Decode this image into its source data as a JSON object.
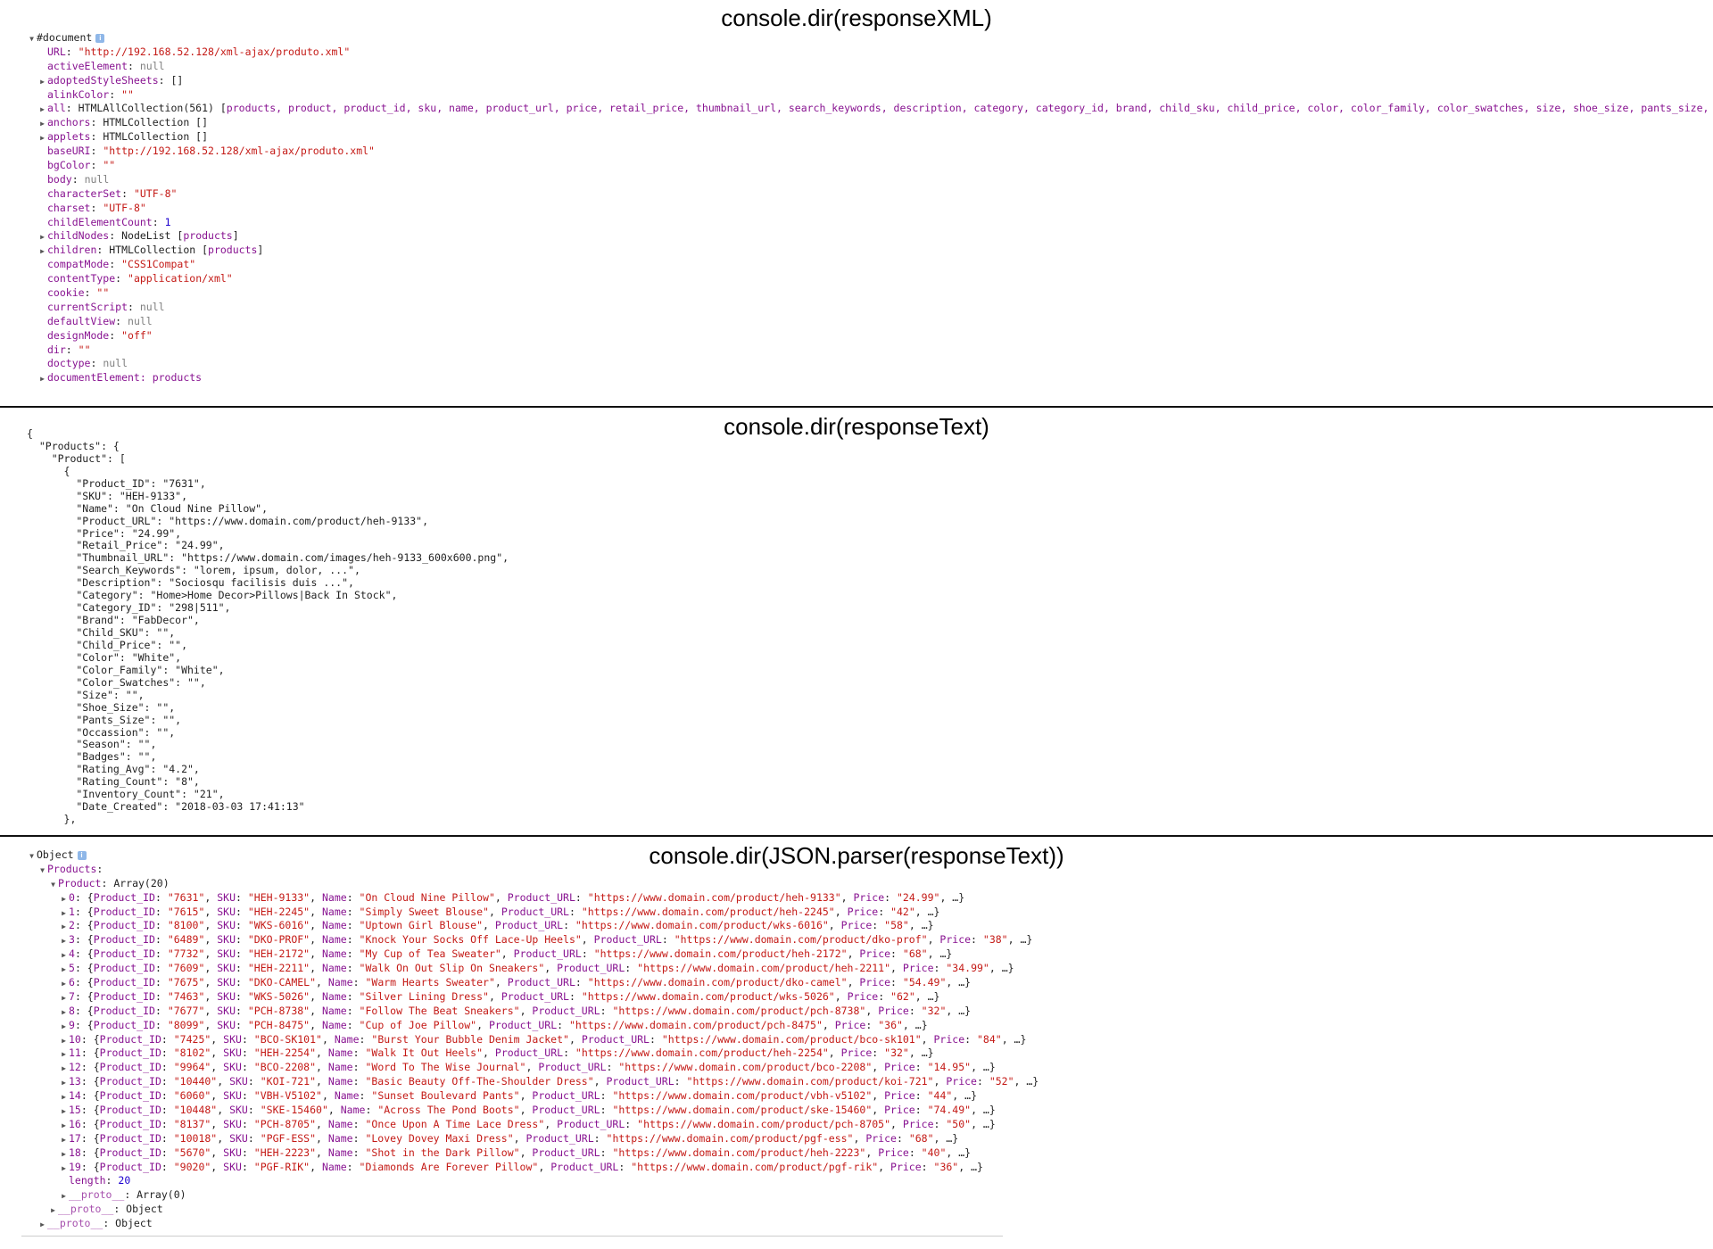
{
  "panels": [
    {
      "caption": "console.dir(responseXML)",
      "lines": [
        {
          "indent": 0,
          "arrow": "open",
          "parts": [
            {
              "t": "#document",
              "c": "plain"
            }
          ],
          "info": true
        },
        {
          "indent": 1,
          "parts": [
            {
              "t": "URL",
              "c": "key"
            },
            {
              "t": ": ",
              "c": "plain"
            },
            {
              "t": "\"http://192.168.52.128/xml-ajax/produto.xml\"",
              "c": "str"
            }
          ]
        },
        {
          "indent": 1,
          "parts": [
            {
              "t": "activeElement",
              "c": "key"
            },
            {
              "t": ": ",
              "c": "plain"
            },
            {
              "t": "null",
              "c": "null"
            }
          ]
        },
        {
          "indent": 1,
          "arrow": "closed",
          "parts": [
            {
              "t": "adoptedStyleSheets",
              "c": "key"
            },
            {
              "t": ": []",
              "c": "plain"
            }
          ]
        },
        {
          "indent": 1,
          "parts": [
            {
              "t": "alinkColor",
              "c": "key"
            },
            {
              "t": ": ",
              "c": "plain"
            },
            {
              "t": "\"\"",
              "c": "str"
            }
          ]
        },
        {
          "indent": 1,
          "arrow": "closed",
          "parts": [
            {
              "t": "all",
              "c": "key"
            },
            {
              "t": ": HTMLAllCollection(561) [",
              "c": "plain"
            },
            {
              "t": "products, product, product_id, sku, name, product_url, price, retail_price, thumbnail_url, search_keywords, description, category, category_id, brand, child_sku, child_price, color, color_family, color_swatches, size, shoe_size, pants_size, …",
              "c": "key"
            }
          ]
        },
        {
          "indent": 1,
          "arrow": "closed",
          "parts": [
            {
              "t": "anchors",
              "c": "key"
            },
            {
              "t": ": HTMLCollection []",
              "c": "plain"
            }
          ]
        },
        {
          "indent": 1,
          "arrow": "closed",
          "parts": [
            {
              "t": "applets",
              "c": "key"
            },
            {
              "t": ": HTMLCollection []",
              "c": "plain"
            }
          ]
        },
        {
          "indent": 1,
          "parts": [
            {
              "t": "baseURI",
              "c": "key"
            },
            {
              "t": ": ",
              "c": "plain"
            },
            {
              "t": "\"http://192.168.52.128/xml-ajax/produto.xml\"",
              "c": "str"
            }
          ]
        },
        {
          "indent": 1,
          "parts": [
            {
              "t": "bgColor",
              "c": "key"
            },
            {
              "t": ": ",
              "c": "plain"
            },
            {
              "t": "\"\"",
              "c": "str"
            }
          ]
        },
        {
          "indent": 1,
          "parts": [
            {
              "t": "body",
              "c": "key"
            },
            {
              "t": ": ",
              "c": "plain"
            },
            {
              "t": "null",
              "c": "null"
            }
          ]
        },
        {
          "indent": 1,
          "parts": [
            {
              "t": "characterSet",
              "c": "key"
            },
            {
              "t": ": ",
              "c": "plain"
            },
            {
              "t": "\"UTF-8\"",
              "c": "str"
            }
          ]
        },
        {
          "indent": 1,
          "parts": [
            {
              "t": "charset",
              "c": "key"
            },
            {
              "t": ": ",
              "c": "plain"
            },
            {
              "t": "\"UTF-8\"",
              "c": "str"
            }
          ]
        },
        {
          "indent": 1,
          "parts": [
            {
              "t": "childElementCount",
              "c": "key"
            },
            {
              "t": ": ",
              "c": "plain"
            },
            {
              "t": "1",
              "c": "num"
            }
          ]
        },
        {
          "indent": 1,
          "arrow": "closed",
          "parts": [
            {
              "t": "childNodes",
              "c": "key"
            },
            {
              "t": ": NodeList [",
              "c": "plain"
            },
            {
              "t": "products",
              "c": "key"
            },
            {
              "t": "]",
              "c": "plain"
            }
          ]
        },
        {
          "indent": 1,
          "arrow": "closed",
          "parts": [
            {
              "t": "children",
              "c": "key"
            },
            {
              "t": ": HTMLCollection [",
              "c": "plain"
            },
            {
              "t": "products",
              "c": "key"
            },
            {
              "t": "]",
              "c": "plain"
            }
          ]
        },
        {
          "indent": 1,
          "parts": [
            {
              "t": "compatMode",
              "c": "key"
            },
            {
              "t": ": ",
              "c": "plain"
            },
            {
              "t": "\"CSS1Compat\"",
              "c": "str"
            }
          ]
        },
        {
          "indent": 1,
          "parts": [
            {
              "t": "contentType",
              "c": "key"
            },
            {
              "t": ": ",
              "c": "plain"
            },
            {
              "t": "\"application/xml\"",
              "c": "str"
            }
          ]
        },
        {
          "indent": 1,
          "parts": [
            {
              "t": "cookie",
              "c": "key"
            },
            {
              "t": ": ",
              "c": "plain"
            },
            {
              "t": "\"\"",
              "c": "str"
            }
          ]
        },
        {
          "indent": 1,
          "parts": [
            {
              "t": "currentScript",
              "c": "key"
            },
            {
              "t": ": ",
              "c": "plain"
            },
            {
              "t": "null",
              "c": "null"
            }
          ]
        },
        {
          "indent": 1,
          "parts": [
            {
              "t": "defaultView",
              "c": "key"
            },
            {
              "t": ": ",
              "c": "plain"
            },
            {
              "t": "null",
              "c": "null"
            }
          ]
        },
        {
          "indent": 1,
          "parts": [
            {
              "t": "designMode",
              "c": "key"
            },
            {
              "t": ": ",
              "c": "plain"
            },
            {
              "t": "\"off\"",
              "c": "str"
            }
          ]
        },
        {
          "indent": 1,
          "parts": [
            {
              "t": "dir",
              "c": "key"
            },
            {
              "t": ": ",
              "c": "plain"
            },
            {
              "t": "\"\"",
              "c": "str"
            }
          ]
        },
        {
          "indent": 1,
          "parts": [
            {
              "t": "doctype",
              "c": "key"
            },
            {
              "t": ": ",
              "c": "plain"
            },
            {
              "t": "null",
              "c": "null"
            }
          ]
        },
        {
          "indent": 1,
          "arrow": "closed",
          "parts": [
            {
              "t": "documentElement",
              "c": "key"
            },
            {
              "t": ": products",
              "c": "key"
            }
          ]
        }
      ]
    },
    {
      "caption": "console.dir(responseText)",
      "json_lines": [
        "{",
        "  \"Products\": {",
        "    \"Product\": [",
        "      {",
        "        \"Product_ID\": \"7631\",",
        "        \"SKU\": \"HEH-9133\",",
        "        \"Name\": \"On Cloud Nine Pillow\",",
        "        \"Product_URL\": \"https://www.domain.com/product/heh-9133\",",
        "        \"Price\": \"24.99\",",
        "        \"Retail_Price\": \"24.99\",",
        "        \"Thumbnail_URL\": \"https://www.domain.com/images/heh-9133_600x600.png\",",
        "        \"Search_Keywords\": \"lorem, ipsum, dolor, ...\",",
        "        \"Description\": \"Sociosqu facilisis duis ...\",",
        "        \"Category\": \"Home>Home Decor>Pillows|Back In Stock\",",
        "        \"Category_ID\": \"298|511\",",
        "        \"Brand\": \"FabDecor\",",
        "        \"Child_SKU\": \"\",",
        "        \"Child_Price\": \"\",",
        "        \"Color\": \"White\",",
        "        \"Color_Family\": \"White\",",
        "        \"Color_Swatches\": \"\",",
        "        \"Size\": \"\",",
        "        \"Shoe_Size\": \"\",",
        "        \"Pants_Size\": \"\",",
        "        \"Occassion\": \"\",",
        "        \"Season\": \"\",",
        "        \"Badges\": \"\",",
        "        \"Rating_Avg\": \"4.2\",",
        "        \"Rating_Count\": \"8\",",
        "        \"Inventory_Count\": \"21\",",
        "        \"Date_Created\": \"2018-03-03 17:41:13\"",
        "      },"
      ]
    },
    {
      "caption": "console.dir(JSON.parser(responseText))",
      "lines": [
        {
          "indent": 0,
          "arrow": "open",
          "parts": [
            {
              "t": "Object",
              "c": "plain"
            }
          ],
          "info": true
        },
        {
          "indent": 1,
          "arrow": "open",
          "parts": [
            {
              "t": "Products",
              "c": "key"
            },
            {
              "t": ":",
              "c": "plain"
            }
          ]
        },
        {
          "indent": 2,
          "arrow": "open",
          "parts": [
            {
              "t": "Product",
              "c": "key"
            },
            {
              "t": ": Array(20)",
              "c": "plain"
            }
          ]
        },
        {
          "indent": 3,
          "arrow": "closed",
          "row": {
            "i": "0",
            "id": "7631",
            "sku": "HEH-9133",
            "name": "On Cloud Nine Pillow",
            "url": "https://www.domain.com/product/heh-9133",
            "price": "24.99"
          }
        },
        {
          "indent": 3,
          "arrow": "closed",
          "row": {
            "i": "1",
            "id": "7615",
            "sku": "HEH-2245",
            "name": "Simply Sweet Blouse",
            "url": "https://www.domain.com/product/heh-2245",
            "price": "42"
          }
        },
        {
          "indent": 3,
          "arrow": "closed",
          "row": {
            "i": "2",
            "id": "8100",
            "sku": "WKS-6016",
            "name": "Uptown Girl Blouse",
            "url": "https://www.domain.com/product/wks-6016",
            "price": "58"
          }
        },
        {
          "indent": 3,
          "arrow": "closed",
          "row": {
            "i": "3",
            "id": "6489",
            "sku": "DKO-PROF",
            "name": "Knock Your Socks Off Lace-Up Heels",
            "url": "https://www.domain.com/product/dko-prof",
            "price": "38"
          }
        },
        {
          "indent": 3,
          "arrow": "closed",
          "row": {
            "i": "4",
            "id": "7732",
            "sku": "HEH-2172",
            "name": "My Cup of Tea Sweater",
            "url": "https://www.domain.com/product/heh-2172",
            "price": "68"
          }
        },
        {
          "indent": 3,
          "arrow": "closed",
          "row": {
            "i": "5",
            "id": "7609",
            "sku": "HEH-2211",
            "name": "Walk On Out Slip On Sneakers",
            "url": "https://www.domain.com/product/heh-2211",
            "price": "34.99"
          }
        },
        {
          "indent": 3,
          "arrow": "closed",
          "row": {
            "i": "6",
            "id": "7675",
            "sku": "DKO-CAMEL",
            "name": "Warm Hearts Sweater",
            "url": "https://www.domain.com/product/dko-camel",
            "price": "54.49"
          }
        },
        {
          "indent": 3,
          "arrow": "closed",
          "row": {
            "i": "7",
            "id": "7463",
            "sku": "WKS-5026",
            "name": "Silver Lining Dress",
            "url": "https://www.domain.com/product/wks-5026",
            "price": "62"
          }
        },
        {
          "indent": 3,
          "arrow": "closed",
          "row": {
            "i": "8",
            "id": "7677",
            "sku": "PCH-8738",
            "name": "Follow The Beat Sneakers",
            "url": "https://www.domain.com/product/pch-8738",
            "price": "32"
          }
        },
        {
          "indent": 3,
          "arrow": "closed",
          "row": {
            "i": "9",
            "id": "8099",
            "sku": "PCH-8475",
            "name": "Cup of Joe Pillow",
            "url": "https://www.domain.com/product/pch-8475",
            "price": "36"
          }
        },
        {
          "indent": 3,
          "arrow": "closed",
          "row": {
            "i": "10",
            "id": "7425",
            "sku": "BCO-SK101",
            "name": "Burst Your Bubble Denim Jacket",
            "url": "https://www.domain.com/product/bco-sk101",
            "price": "84"
          }
        },
        {
          "indent": 3,
          "arrow": "closed",
          "row": {
            "i": "11",
            "id": "8102",
            "sku": "HEH-2254",
            "name": "Walk It Out Heels",
            "url": "https://www.domain.com/product/heh-2254",
            "price": "32"
          }
        },
        {
          "indent": 3,
          "arrow": "closed",
          "row": {
            "i": "12",
            "id": "9964",
            "sku": "BCO-2208",
            "name": "Word To The Wise Journal",
            "url": "https://www.domain.com/product/bco-2208",
            "price": "14.95"
          }
        },
        {
          "indent": 3,
          "arrow": "closed",
          "row": {
            "i": "13",
            "id": "10440",
            "sku": "KOI-721",
            "name": "Basic Beauty Off-The-Shoulder Dress",
            "url": "https://www.domain.com/product/koi-721",
            "price": "52"
          }
        },
        {
          "indent": 3,
          "arrow": "closed",
          "row": {
            "i": "14",
            "id": "6060",
            "sku": "VBH-V5102",
            "name": "Sunset Boulevard Pants",
            "url": "https://www.domain.com/product/vbh-v5102",
            "price": "44"
          }
        },
        {
          "indent": 3,
          "arrow": "closed",
          "row": {
            "i": "15",
            "id": "10448",
            "sku": "SKE-15460",
            "name": "Across The Pond Boots",
            "url": "https://www.domain.com/product/ske-15460",
            "price": "74.49"
          }
        },
        {
          "indent": 3,
          "arrow": "closed",
          "row": {
            "i": "16",
            "id": "8137",
            "sku": "PCH-8705",
            "name": "Once Upon A Time Lace Dress",
            "url": "https://www.domain.com/product/pch-8705",
            "price": "50"
          }
        },
        {
          "indent": 3,
          "arrow": "closed",
          "row": {
            "i": "17",
            "id": "10018",
            "sku": "PGF-ESS",
            "name": "Lovey Dovey Maxi Dress",
            "url": "https://www.domain.com/product/pgf-ess",
            "price": "68"
          }
        },
        {
          "indent": 3,
          "arrow": "closed",
          "row": {
            "i": "18",
            "id": "5670",
            "sku": "HEH-2223",
            "name": "Shot in the Dark Pillow",
            "url": "https://www.domain.com/product/heh-2223",
            "price": "40"
          }
        },
        {
          "indent": 3,
          "arrow": "closed",
          "row": {
            "i": "19",
            "id": "9020",
            "sku": "PGF-RIK",
            "name": "Diamonds Are Forever Pillow",
            "url": "https://www.domain.com/product/pgf-rik",
            "price": "36"
          }
        },
        {
          "indent": 3,
          "parts": [
            {
              "t": "length",
              "c": "key"
            },
            {
              "t": ": ",
              "c": "plain"
            },
            {
              "t": "20",
              "c": "num"
            }
          ]
        },
        {
          "indent": 3,
          "arrow": "closed",
          "parts": [
            {
              "t": "__proto__",
              "c": "proto"
            },
            {
              "t": ": Array(0)",
              "c": "plain"
            }
          ]
        },
        {
          "indent": 2,
          "arrow": "closed",
          "parts": [
            {
              "t": "__proto__",
              "c": "proto"
            },
            {
              "t": ": Object",
              "c": "plain"
            }
          ]
        },
        {
          "indent": 1,
          "arrow": "closed",
          "parts": [
            {
              "t": "__proto__",
              "c": "proto"
            },
            {
              "t": ": Object",
              "c": "plain"
            }
          ]
        }
      ]
    }
  ],
  "colors": {
    "key": "#881391",
    "string": "#c41a16",
    "number": "#1c00cf",
    "null": "#808080"
  }
}
